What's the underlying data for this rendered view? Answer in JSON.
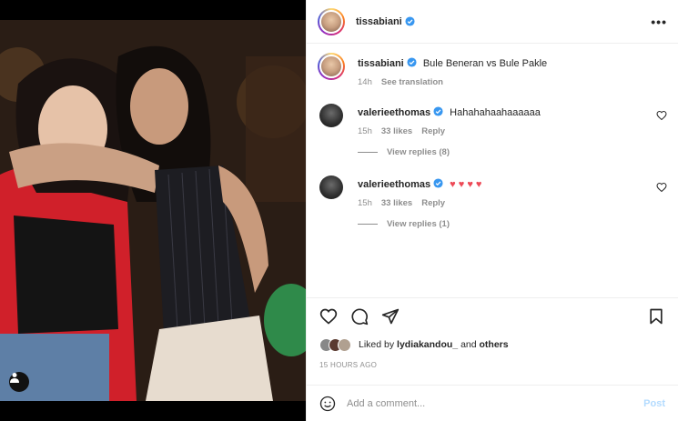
{
  "post": {
    "author": "tissabiani",
    "caption": "Bule Beneran vs Bule Pakle",
    "caption_time": "14h",
    "see_translation": "See translation",
    "posted_ago": "15 HOURS AGO"
  },
  "comments": [
    {
      "user": "valerieethomas",
      "text": "Hahahahaahaaaaaa",
      "time": "15h",
      "likes": "33 likes",
      "reply": "Reply",
      "view_replies": "View replies (8)"
    },
    {
      "user": "valerieethomas",
      "text": "♥ ♥ ♥ ♥",
      "time": "15h",
      "likes": "33 likes",
      "reply": "Reply",
      "view_replies": "View replies (1)"
    }
  ],
  "likes": {
    "prefix": "Liked by",
    "user": "lydiakandou_",
    "and": "and",
    "others": "others"
  },
  "add_comment": {
    "placeholder": "Add a comment...",
    "post_label": "Post"
  },
  "more_label": "•••",
  "colors": {
    "verified": "#3897f0",
    "heart_red": "#ed4956",
    "post_disabled": "#b3dbff",
    "meta_gray": "#8e8e8e"
  }
}
